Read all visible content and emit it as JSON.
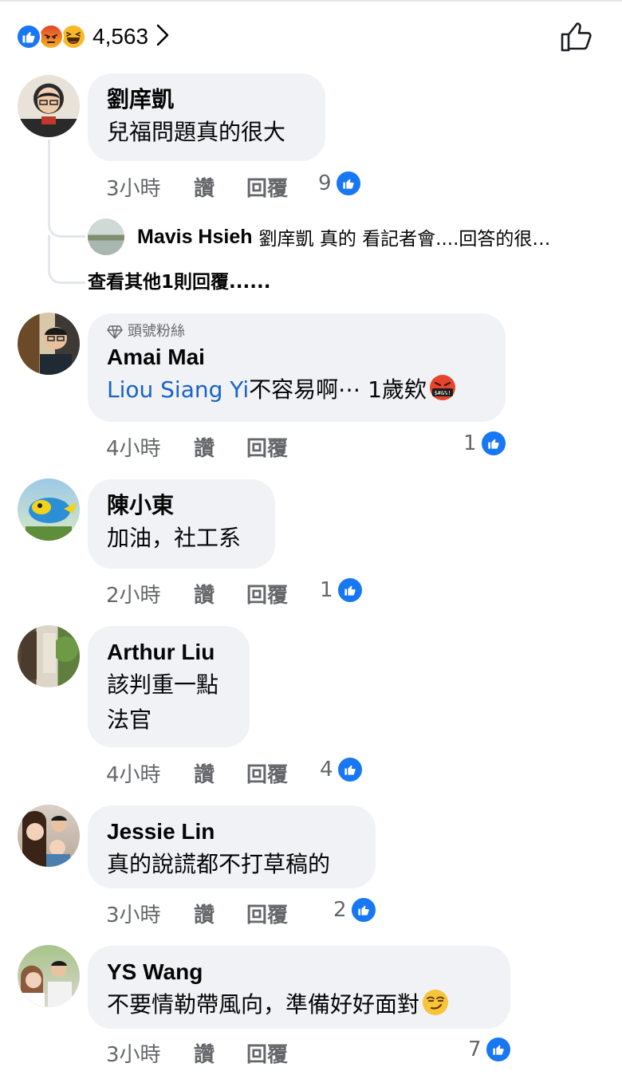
{
  "reactions": {
    "icons": [
      "like-icon",
      "angry-icon",
      "haha-icon"
    ],
    "count": "4,563"
  },
  "colors": {
    "accent": "#1877f2",
    "bubble": "#f0f2f5",
    "mention": "#1a63c7",
    "meta": "#65676b"
  },
  "actions": {
    "like": "讚",
    "reply": "回覆"
  },
  "comments": [
    {
      "name": "劉庠凱",
      "lines": [
        "兒福問題真的很大"
      ],
      "time": "3小時",
      "likes": "9"
    },
    {
      "badge": "頭號粉絲",
      "name": "Amai Mai",
      "mention": "Liou Siang Yi",
      "text_after": "不容易啊⋯ 1歲欸",
      "time": "4小時",
      "likes": "1"
    },
    {
      "name": "陳小東",
      "lines": [
        "加油，社工系"
      ],
      "time": "2小時",
      "likes": "1"
    },
    {
      "name": "Arthur Liu",
      "lines": [
        "該判重一點",
        "法官"
      ],
      "time": "4小時",
      "likes": "4"
    },
    {
      "name": "Jessie Lin",
      "lines": [
        "真的說謊都不打草稿的"
      ],
      "time": "3小時",
      "likes": "2"
    },
    {
      "name": "YS Wang",
      "lines": [
        "不要情勒帶風向，準備好好面對"
      ],
      "time": "3小時",
      "likes": "7"
    }
  ],
  "reply": {
    "name": "Mavis Hsieh",
    "text": "劉庠凱 真的 看記者會....回答的很…"
  },
  "more_replies": "查看其他1則回覆......"
}
